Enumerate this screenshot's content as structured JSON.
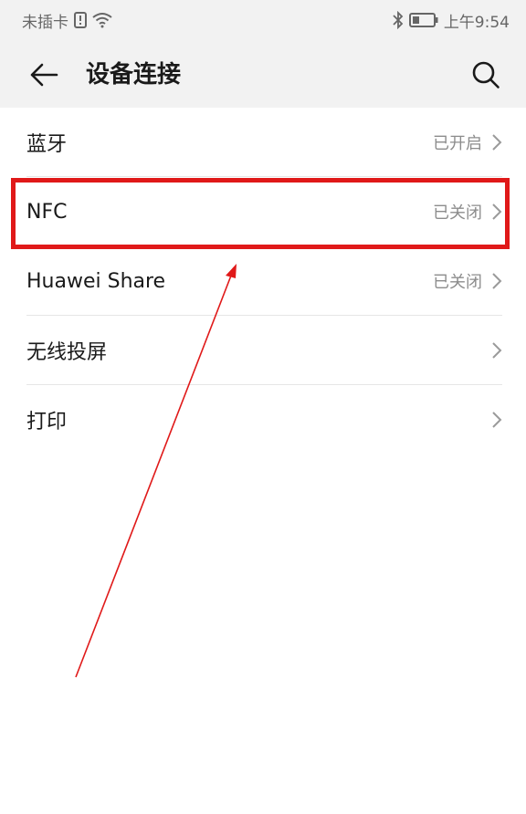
{
  "status_bar": {
    "carrier": "未插卡",
    "time": "上午9:54",
    "icons": [
      "sim-alert-icon",
      "wifi-icon",
      "bluetooth-icon",
      "battery-icon"
    ]
  },
  "header": {
    "title": "设备连接",
    "back_icon": "arrow-left-icon",
    "search_icon": "search-icon"
  },
  "list": {
    "items": [
      {
        "label": "蓝牙",
        "status": "已开启"
      },
      {
        "label": "NFC",
        "status": "已关闭"
      },
      {
        "label": "Huawei Share",
        "status": "已关闭"
      },
      {
        "label": "无线投屏",
        "status": ""
      },
      {
        "label": "打印",
        "status": ""
      }
    ]
  },
  "colors": {
    "background": "#ffffff",
    "header_background": "#f2f2f2",
    "annotation": "#e01919",
    "secondary_text": "#8c8c8c"
  }
}
